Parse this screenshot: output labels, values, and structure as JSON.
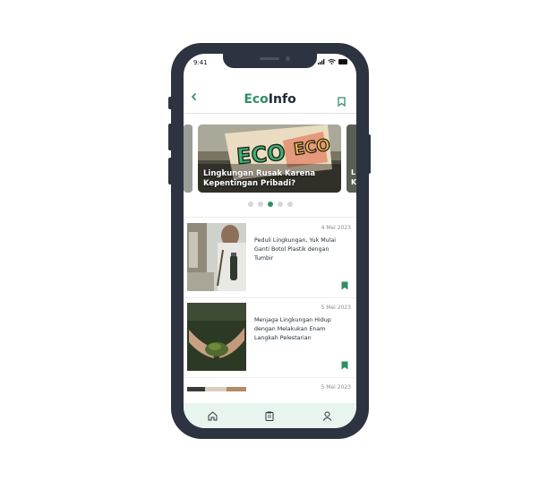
{
  "status_bar": {
    "time": "9:41"
  },
  "header": {
    "logo_eco": "Eco",
    "logo_info": "Info"
  },
  "carousel": {
    "main_title": "Lingkungan Rusak Karena Kepentingan Pribadi?",
    "peek_right_text": "L K",
    "sign_text": "ECO",
    "sign_text2": "ECO",
    "dot_count": 5,
    "active_dot": 2
  },
  "articles": [
    {
      "date": "4 Mei 2023",
      "title": "Peduli Lingkungan, Yuk Mulai Ganti Botol Plastik dengan Tumbir"
    },
    {
      "date": "5 Mei 2023",
      "title": "Menjaga Lingkungan Hidup dengan Melakukan Enam Langkah Pelestarian"
    },
    {
      "date": "5 Mei 2023",
      "title": ""
    }
  ],
  "icons": {
    "back": "chevron-left-icon",
    "bookmark": "bookmark-icon",
    "home": "home-icon",
    "clipboard": "clipboard-icon",
    "user": "user-icon"
  },
  "colors": {
    "accent": "#2f8f63",
    "frame": "#2d3340",
    "nav_bg": "#e8f5ee"
  }
}
